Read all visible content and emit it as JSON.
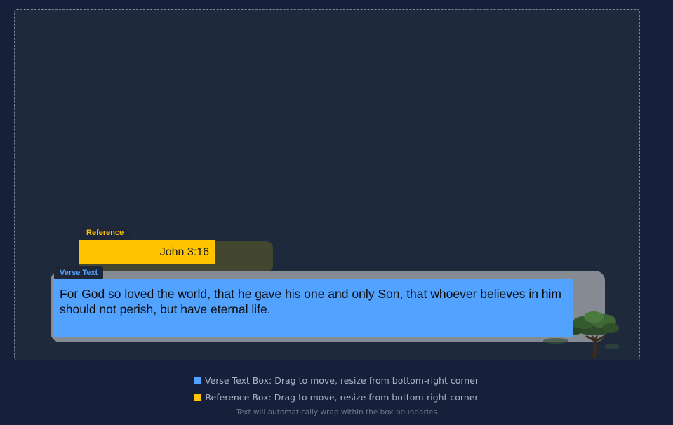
{
  "reference": {
    "tag": "Reference",
    "text": "John 3:16",
    "color": "#ffc400"
  },
  "verse": {
    "tag": "Verse Text",
    "text": "For God so loved the world, that he gave his one and only Son, that whoever believes in him should not perish, but have eternal life.",
    "color": "#52a2ff"
  },
  "background_image": {
    "icon": "tree-icon"
  },
  "legend": {
    "verse_label": "Verse Text Box: Drag to move, resize from bottom-right corner",
    "reference_label": "Reference Box: Drag to move, resize from bottom-right corner",
    "hint": "Text will automatically wrap within the box boundaries"
  }
}
